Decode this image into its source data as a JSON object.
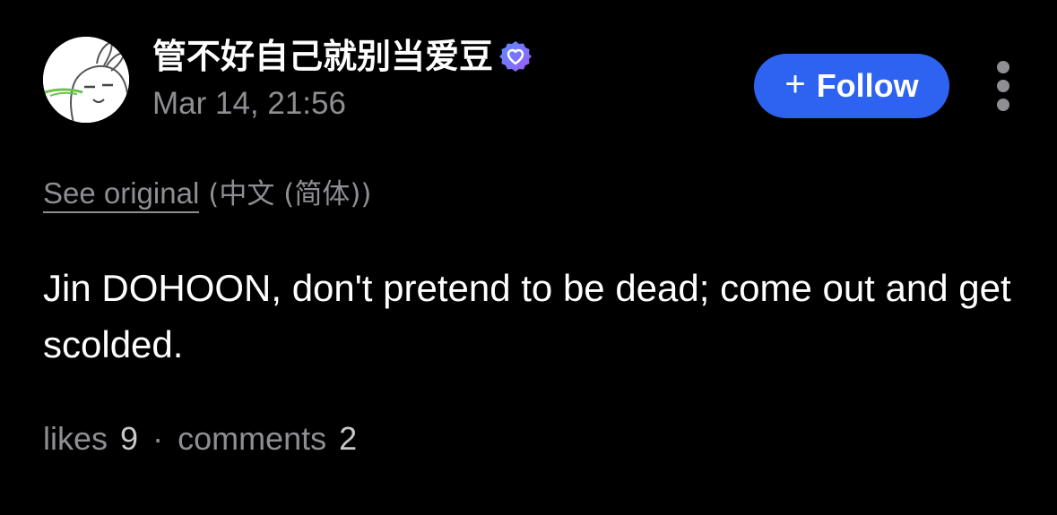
{
  "author": {
    "name": "管不好自己就别当爱豆",
    "avatar_icon": "cartoon-bunny-avatar",
    "verified_icon": "verified-heart-badge-icon"
  },
  "post": {
    "timestamp": "Mar 14, 21:56",
    "translation_link": "See original",
    "translation_lang": "(中文 (简体))",
    "text": "Jin DOHOON, don't pretend to be dead; come out and get scolded."
  },
  "actions": {
    "follow_plus": "+",
    "follow_label": "Follow",
    "more_icon": "vertical-ellipsis-icon"
  },
  "stats": {
    "likes_label": "likes",
    "likes_count": "9",
    "separator": "·",
    "comments_label": "comments",
    "comments_count": "2"
  },
  "colors": {
    "background": "#000000",
    "primary_text": "#ffffff",
    "secondary_text": "#8e8e93",
    "follow_button": "#2d63f0",
    "verified_badge": "#7b6cf6"
  }
}
